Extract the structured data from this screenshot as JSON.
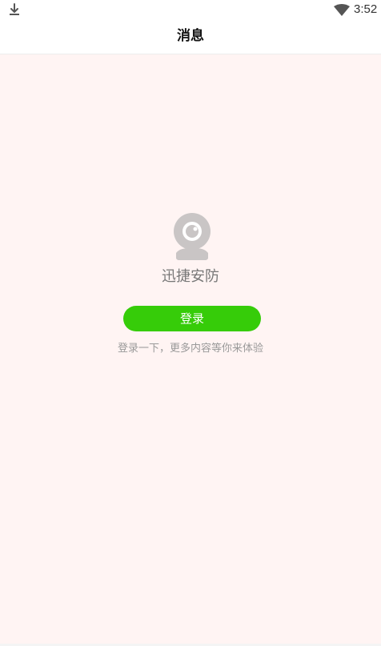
{
  "status_bar": {
    "left_icon": "download-icon",
    "right_icon": "wifi-icon",
    "time": "3:52"
  },
  "header": {
    "title": "消息"
  },
  "empty_state": {
    "icon": "camera-icon",
    "app_name": "迅捷安防",
    "login_button_label": "登录",
    "hint": "登录一下，更多内容等你来体验"
  },
  "colors": {
    "page_background": "#fff4f3",
    "header_background": "#ffffff",
    "login_button": "#36cc09",
    "icon_gray": "#c9c5c5"
  }
}
